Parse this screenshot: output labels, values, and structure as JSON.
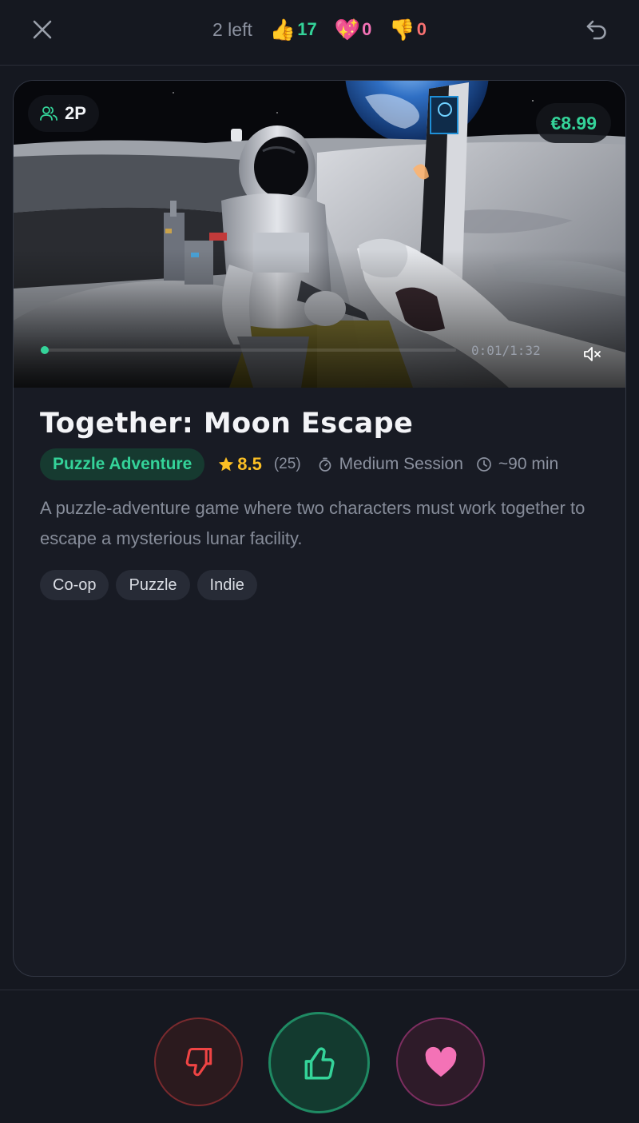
{
  "header": {
    "remaining": "2 left",
    "likes": {
      "icon": "thumbs-up-emoji",
      "glyph": "👍",
      "value": "17",
      "color": "#34d399"
    },
    "loves": {
      "icon": "sparkling-heart-emoji",
      "glyph": "💖",
      "value": "0",
      "color": "#f472b6"
    },
    "dislikes": {
      "icon": "thumbs-down-emoji",
      "glyph": "👎",
      "value": "0",
      "color": "#f87171"
    },
    "close_icon": "close-icon",
    "undo_icon": "undo-icon"
  },
  "game": {
    "players": "2P",
    "price": "€8.99",
    "video": {
      "time": "0:01/1:32",
      "progress": 0.01,
      "muted": true
    },
    "title": "Together: Moon Escape",
    "genre": "Puzzle Adventure",
    "rating": "8.5",
    "rating_count": "(25)",
    "session": "Medium Session",
    "duration": "~90 min",
    "description": "A puzzle-adventure game where two characters must work together to escape a mysterious lunar facility.",
    "tags": [
      "Co-op",
      "Puzzle",
      "Indie"
    ]
  },
  "actions": {
    "dislike_icon": "thumbs-down-icon",
    "like_icon": "thumbs-up-icon",
    "love_icon": "heart-icon"
  },
  "colors": {
    "accent": "#34d399",
    "star": "#fbbf24",
    "love": "#f472b6",
    "dislike": "#f87171",
    "background": "#151820"
  }
}
